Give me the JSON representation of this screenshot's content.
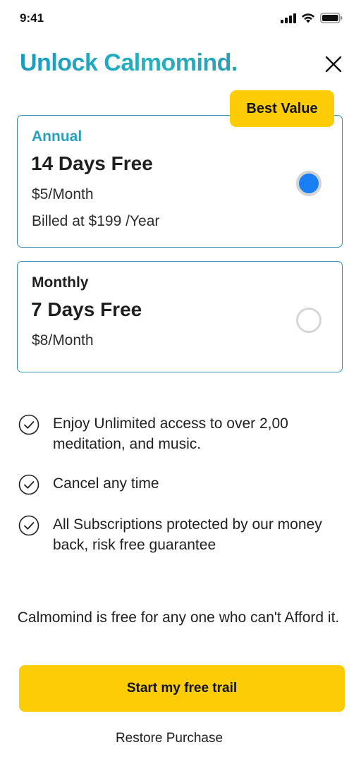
{
  "status_bar": {
    "time": "9:41",
    "icons": [
      "cellular-signal-icon",
      "wifi-icon",
      "battery-icon"
    ]
  },
  "header": {
    "title": "Unlock Calmomind.",
    "close_icon": "close-icon"
  },
  "plans": [
    {
      "badge": "Best Value",
      "name": "Annual",
      "trial": "14 Days Free",
      "price": "$5/Month",
      "billed": "Billed at $199 /Year",
      "selected": true
    },
    {
      "name": "Monthly",
      "trial": "7 Days Free",
      "price": "$8/Month",
      "selected": false
    }
  ],
  "features": [
    {
      "icon": "check-circle-icon",
      "text": "Enjoy Unlimited access to over 2,00 meditation, and music."
    },
    {
      "icon": "check-circle-icon",
      "text": "Cancel any time"
    },
    {
      "icon": "check-circle-icon",
      "text": "All Subscriptions protected by our money back, risk free guarantee"
    }
  ],
  "free_note": "Calmomind is free for any one who can't Afford it.",
  "cta": {
    "label": "Start my free trail"
  },
  "restore": {
    "label": "Restore Purchase"
  },
  "colors": {
    "title_teal": "#1aa0bc",
    "accent_yellow": "#fccc06",
    "radio_blue": "#1a7ff2",
    "card_border": "#2f8fb0"
  }
}
